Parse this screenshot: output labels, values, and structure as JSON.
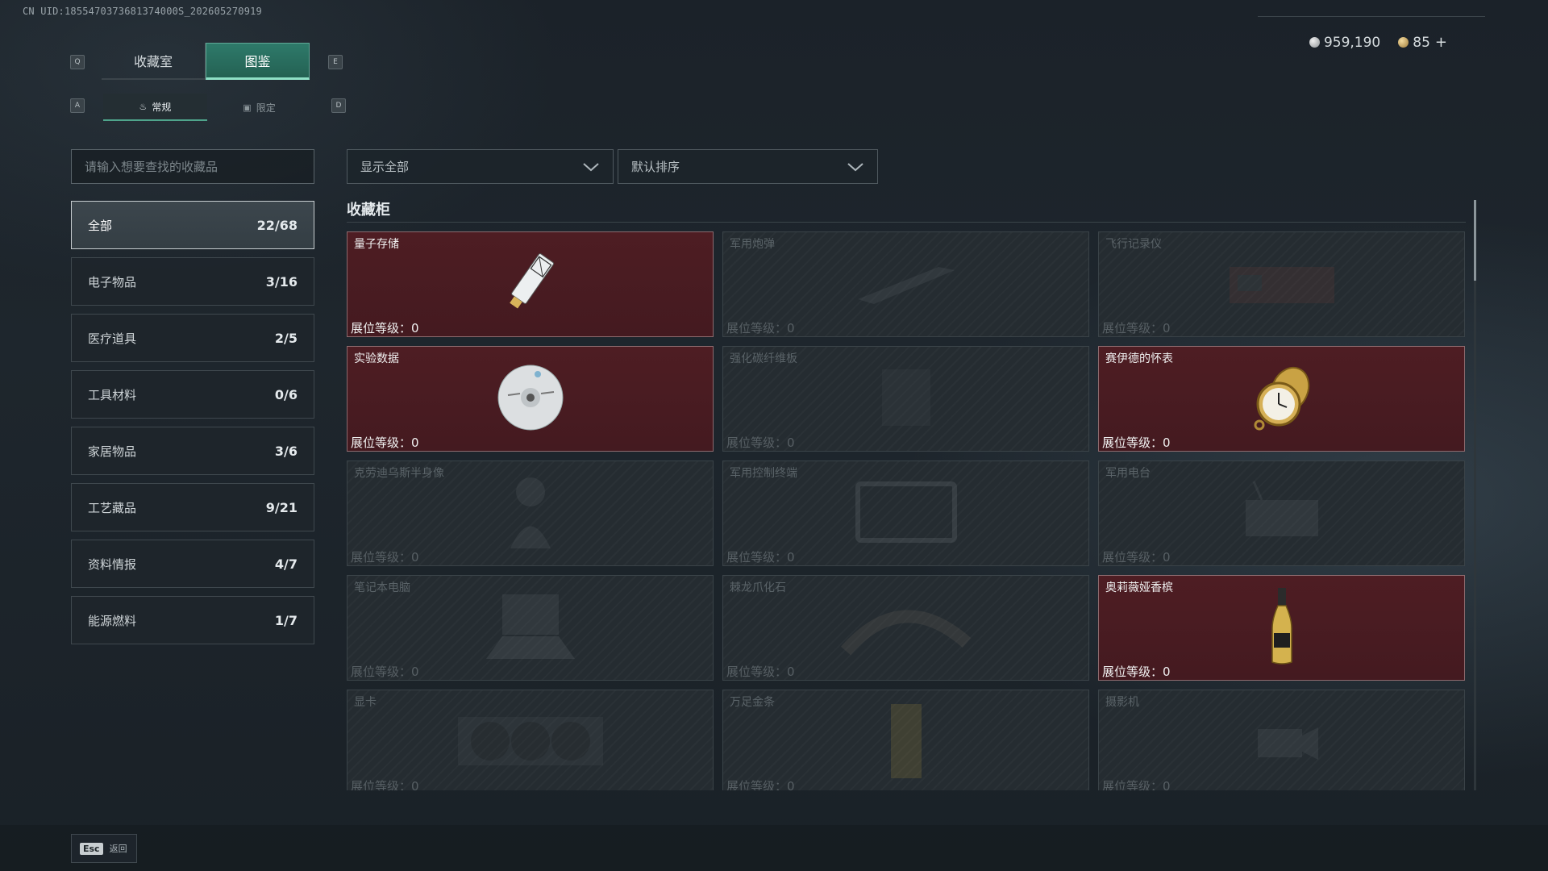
{
  "uid": "CN UID:1855470373681374000S_202605270919",
  "key_hints": {
    "q": "Q",
    "e": "E",
    "a": "A",
    "d": "D"
  },
  "tabs_main": [
    {
      "label": "收藏室",
      "active": false
    },
    {
      "label": "图鉴",
      "active": true
    }
  ],
  "tabs_sub": [
    {
      "label": "常规",
      "active": true
    },
    {
      "label": "限定",
      "active": false
    }
  ],
  "currency": {
    "silver": "959,190",
    "gold": "85",
    "plus": "+"
  },
  "search": {
    "placeholder": "请输入想要查找的收藏品"
  },
  "filters": {
    "show": "显示全部",
    "sort": "默认排序"
  },
  "categories": [
    {
      "label": "全部",
      "count": "22/68",
      "active": true
    },
    {
      "label": "电子物品",
      "count": "3/16"
    },
    {
      "label": "医疗道具",
      "count": "2/5"
    },
    {
      "label": "工具材料",
      "count": "0/6"
    },
    {
      "label": "家居物品",
      "count": "3/6"
    },
    {
      "label": "工艺藏品",
      "count": "9/21"
    },
    {
      "label": "资料情报",
      "count": "4/7"
    },
    {
      "label": "能源燃料",
      "count": "1/7"
    }
  ],
  "section_title": "收藏柜",
  "level_label": "展位等级：",
  "items": [
    {
      "name": "量子存储",
      "level": "0",
      "owned": true,
      "icon": "ssd-icon"
    },
    {
      "name": "军用炮弹",
      "level": "0",
      "owned": false,
      "icon": "shell-icon"
    },
    {
      "name": "飞行记录仪",
      "level": "0",
      "owned": false,
      "icon": "recorder-icon"
    },
    {
      "name": "实验数据",
      "level": "0",
      "owned": true,
      "icon": "disc-icon"
    },
    {
      "name": "强化碳纤维板",
      "level": "0",
      "owned": false,
      "icon": "plate-icon"
    },
    {
      "name": "赛伊德的怀表",
      "level": "0",
      "owned": true,
      "icon": "pocket-watch-icon"
    },
    {
      "name": "克劳迪乌斯半身像",
      "level": "0",
      "owned": false,
      "icon": "bust-icon"
    },
    {
      "name": "军用控制终端",
      "level": "0",
      "owned": false,
      "icon": "terminal-icon"
    },
    {
      "name": "军用电台",
      "level": "0",
      "owned": false,
      "icon": "radio-icon"
    },
    {
      "name": "笔记本电脑",
      "level": "0",
      "owned": false,
      "icon": "laptop-icon"
    },
    {
      "name": "棘龙爪化石",
      "level": "0",
      "owned": false,
      "icon": "fossil-icon"
    },
    {
      "name": "奥莉薇娅香槟",
      "level": "0",
      "owned": true,
      "icon": "champagne-icon"
    },
    {
      "name": "显卡",
      "level": "0",
      "owned": false,
      "icon": "gpu-icon"
    },
    {
      "name": "万足金条",
      "level": "0",
      "owned": false,
      "icon": "gold-bar-icon"
    },
    {
      "name": "摄影机",
      "level": "0",
      "owned": false,
      "icon": "camera-icon"
    }
  ],
  "footer": {
    "esc_key": "Esc",
    "esc_label": "返回"
  }
}
